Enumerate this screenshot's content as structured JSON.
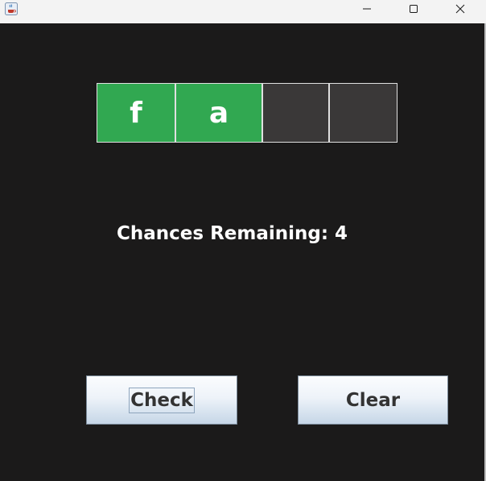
{
  "window": {
    "app_icon": "java-coffee-cup-icon",
    "minimize_icon": "minimize-icon",
    "maximize_icon": "maximize-icon",
    "close_icon": "close-icon"
  },
  "board": {
    "tiles": [
      {
        "letter": "f",
        "state": "correct",
        "color": "#31a851"
      },
      {
        "letter": "a",
        "state": "correct",
        "color": "#31a851"
      },
      {
        "letter": "",
        "state": "empty",
        "color": "#3a3838"
      },
      {
        "letter": "",
        "state": "empty",
        "color": "#3a3838"
      }
    ]
  },
  "status": {
    "chances_text": "Chances Remaining: 4"
  },
  "buttons": {
    "check_label": "Check",
    "clear_label": "Clear"
  },
  "colors": {
    "background": "#1b1a1a",
    "correct": "#31a851",
    "empty": "#3a3838",
    "text": "#ffffff"
  }
}
